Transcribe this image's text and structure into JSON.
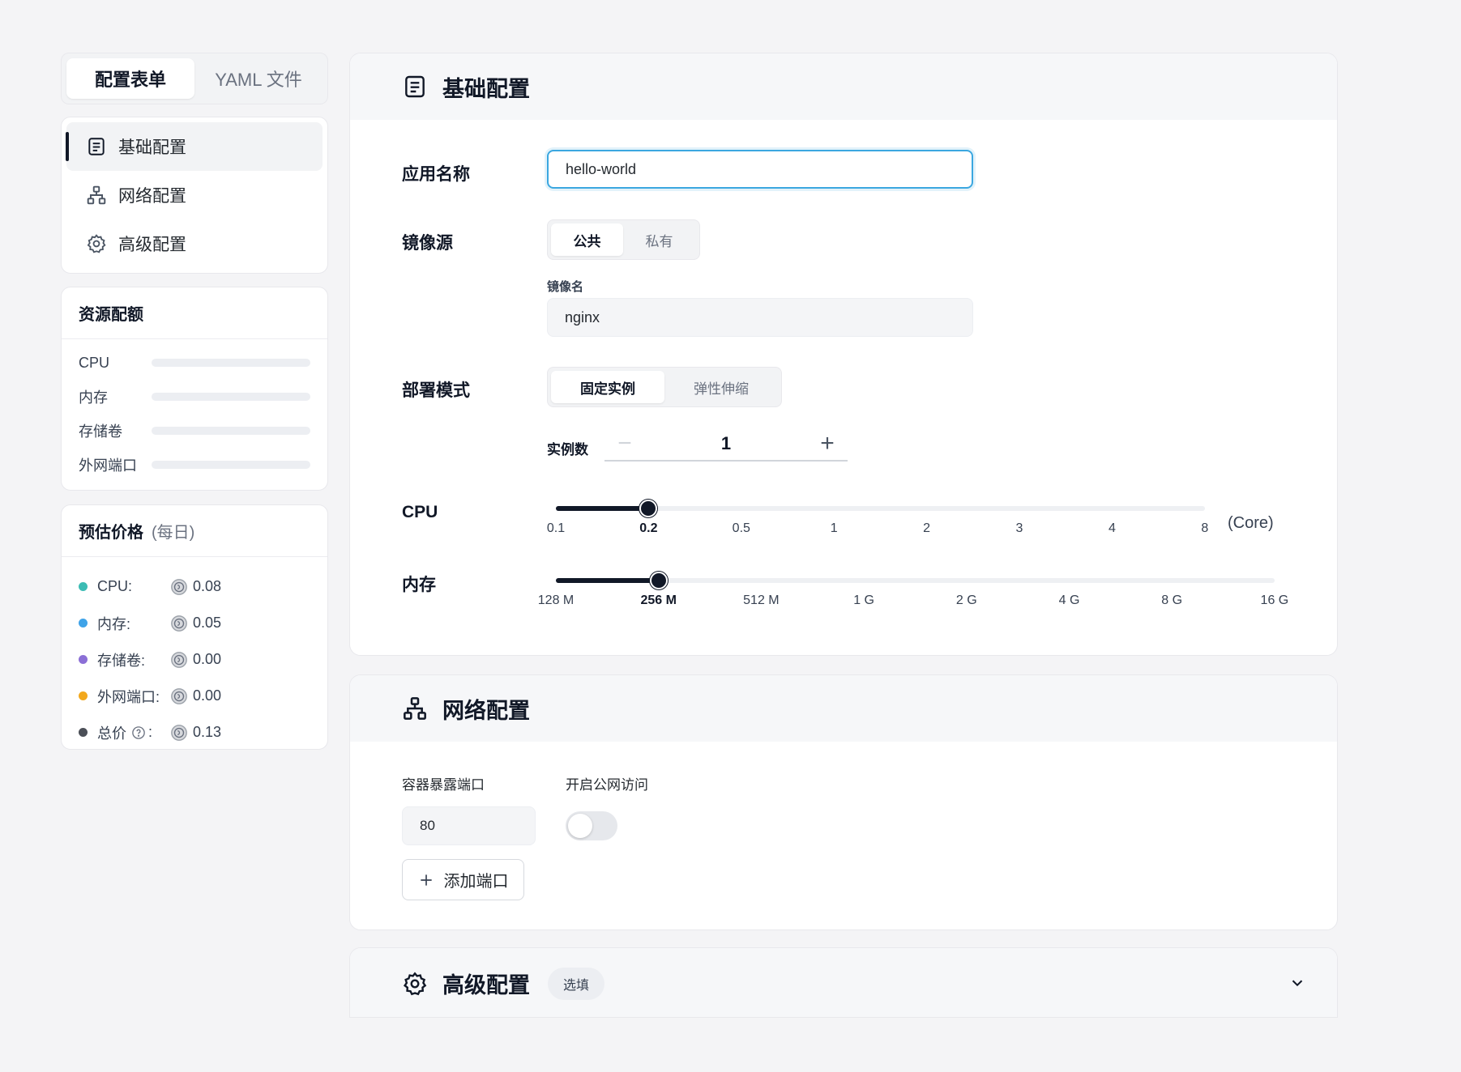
{
  "tabs": [
    {
      "label": "配置表单",
      "active": true
    },
    {
      "label": "YAML 文件",
      "active": false
    }
  ],
  "nav": [
    {
      "label": "基础配置",
      "icon": "document-icon",
      "active": true
    },
    {
      "label": "网络配置",
      "icon": "network-icon",
      "active": false
    },
    {
      "label": "高级配置",
      "icon": "gear-icon",
      "active": false
    }
  ],
  "quota": {
    "title": "资源配额",
    "rows": [
      "CPU",
      "内存",
      "存储卷",
      "外网端口"
    ]
  },
  "price": {
    "title": "预估价格",
    "subtitle": "(每日)",
    "rows": [
      {
        "label": "CPU:",
        "value": "0.08",
        "color": "#3cbcb4"
      },
      {
        "label": "内存:",
        "value": "0.05",
        "color": "#3fa3e8"
      },
      {
        "label": "存储卷:",
        "value": "0.00",
        "color": "#8b6fd6"
      },
      {
        "label": "外网端口:",
        "value": "0.00",
        "color": "#f2a81d"
      },
      {
        "label": "总价",
        "value": "0.13",
        "color": "#4b4f57",
        "suffix": ":"
      }
    ]
  },
  "basic": {
    "title": "基础配置",
    "app_name_label": "应用名称",
    "app_name_value": "hello-world",
    "image_source_label": "镜像源",
    "image_source_options": [
      "公共",
      "私有"
    ],
    "image_name_label": "镜像名",
    "image_name_value": "nginx",
    "deploy_mode_label": "部署模式",
    "deploy_mode_options": [
      "固定实例",
      "弹性伸缩"
    ],
    "replicas_label": "实例数",
    "replicas_value": "1",
    "cpu_label": "CPU",
    "cpu_ticks": [
      "0.1",
      "0.2",
      "0.5",
      "1",
      "2",
      "3",
      "4",
      "8"
    ],
    "cpu_selected_index": 1,
    "cpu_unit": "(Core)",
    "memory_label": "内存",
    "memory_ticks": [
      "128 M",
      "256 M",
      "512 M",
      "1 G",
      "2 G",
      "4 G",
      "8 G",
      "16 G"
    ],
    "memory_selected_index": 1
  },
  "network": {
    "title": "网络配置",
    "port_label": "容器暴露端口",
    "public_label": "开启公网访问",
    "port_value": "80",
    "public_enabled": false,
    "add_port_label": "添加端口"
  },
  "advanced": {
    "title": "高级配置",
    "badge": "选填"
  }
}
